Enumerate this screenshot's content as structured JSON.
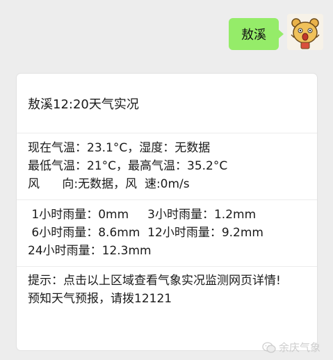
{
  "outgoing_message": {
    "text": "敖溪"
  },
  "card": {
    "title": "敖溪12:20天气实况",
    "weather_lines": [
      "现在气温：23.1°C，湿度：无数据",
      "最低气温：21°C，最高气温：35.2°C",
      "风      向:无数据，风  速:0m/s"
    ],
    "rain_lines": [
      " 1小时雨量：0mm     3小时雨量：1.2mm",
      " 6小时雨量：8.6mm  12小时雨量：9.2mm",
      "24小时雨量：12.3mm"
    ],
    "tip_lines": [
      "提示：点击以上区域查看气象实况监测网页详情!",
      "预知天气预报，请拨12121"
    ]
  },
  "watermark": {
    "text": "余庆气象"
  },
  "colors": {
    "background": "#ededed",
    "outgoing_bubble": "#95ec69",
    "card": "#ffffff"
  }
}
